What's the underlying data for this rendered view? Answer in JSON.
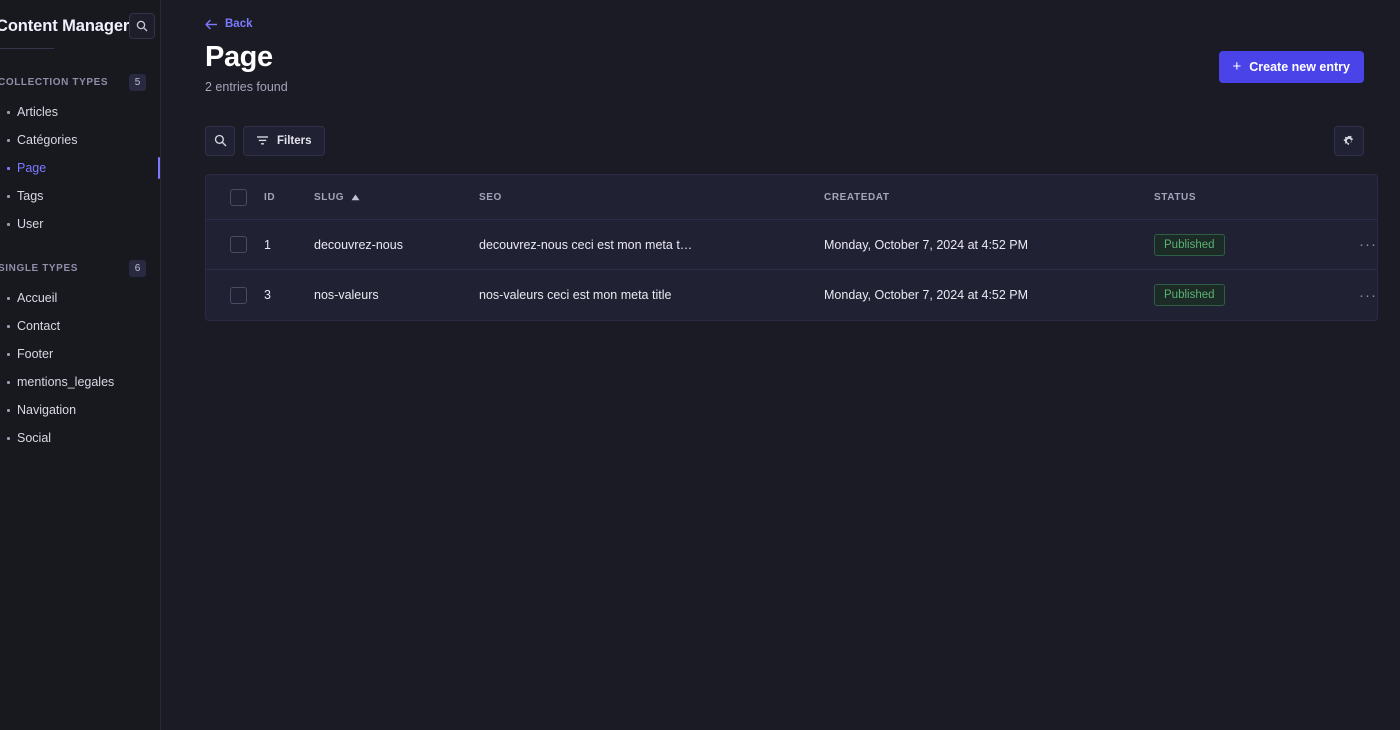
{
  "sidebar": {
    "title": "Content Manager",
    "search_icon": "search-icon",
    "sections": [
      {
        "title": "COLLECTION TYPES",
        "count": "5",
        "items": [
          {
            "label": "Articles",
            "active": false
          },
          {
            "label": "Catégories",
            "active": false
          },
          {
            "label": "Page",
            "active": true
          },
          {
            "label": "Tags",
            "active": false
          },
          {
            "label": "User",
            "active": false
          }
        ]
      },
      {
        "title": "SINGLE TYPES",
        "count": "6",
        "items": [
          {
            "label": "Accueil",
            "active": false
          },
          {
            "label": "Contact",
            "active": false
          },
          {
            "label": "Footer",
            "active": false
          },
          {
            "label": "mentions_legales",
            "active": false
          },
          {
            "label": "Navigation",
            "active": false
          },
          {
            "label": "Social",
            "active": false
          }
        ]
      }
    ]
  },
  "main": {
    "back_label": "Back",
    "back_icon": "arrow-left-icon",
    "page_title": "Page",
    "entries_found": "2 entries found",
    "create_button": {
      "label": "Create new entry",
      "plus": "+",
      "color": "#4a43e8"
    },
    "toolbar": {
      "search_icon": "search-icon",
      "filters_label": "Filters",
      "filters_icon": "filter-icon",
      "settings_icon": "gear-icon"
    },
    "table": {
      "columns": [
        {
          "key": "id",
          "label": "ID",
          "sorted": false
        },
        {
          "key": "slug",
          "label": "SLUG",
          "sorted": true,
          "sort_dir": "asc"
        },
        {
          "key": "seo",
          "label": "SEO",
          "sorted": false
        },
        {
          "key": "createdAt",
          "label": "CREATEDAT",
          "sorted": false
        },
        {
          "key": "status",
          "label": "STATUS",
          "sorted": false
        }
      ],
      "rows": [
        {
          "id": "1",
          "slug": "decouvrez-nous",
          "seo": "decouvrez-nous ceci est mon meta t…",
          "createdAt": "Monday, October 7, 2024 at 4:52 PM",
          "status": "Published",
          "actions": "···"
        },
        {
          "id": "3",
          "slug": "nos-valeurs",
          "seo": "nos-valeurs ceci est mon meta title",
          "createdAt": "Monday, October 7, 2024 at 4:52 PM",
          "status": "Published",
          "actions": "···"
        }
      ]
    }
  },
  "colors": {
    "accent": "#7b79ff",
    "brand_button": "#4a43e8",
    "status_published": "#5cb176",
    "page_bg": "#1b1b26",
    "panel_bg": "#212134",
    "sidebar_bg": "#18181f"
  }
}
